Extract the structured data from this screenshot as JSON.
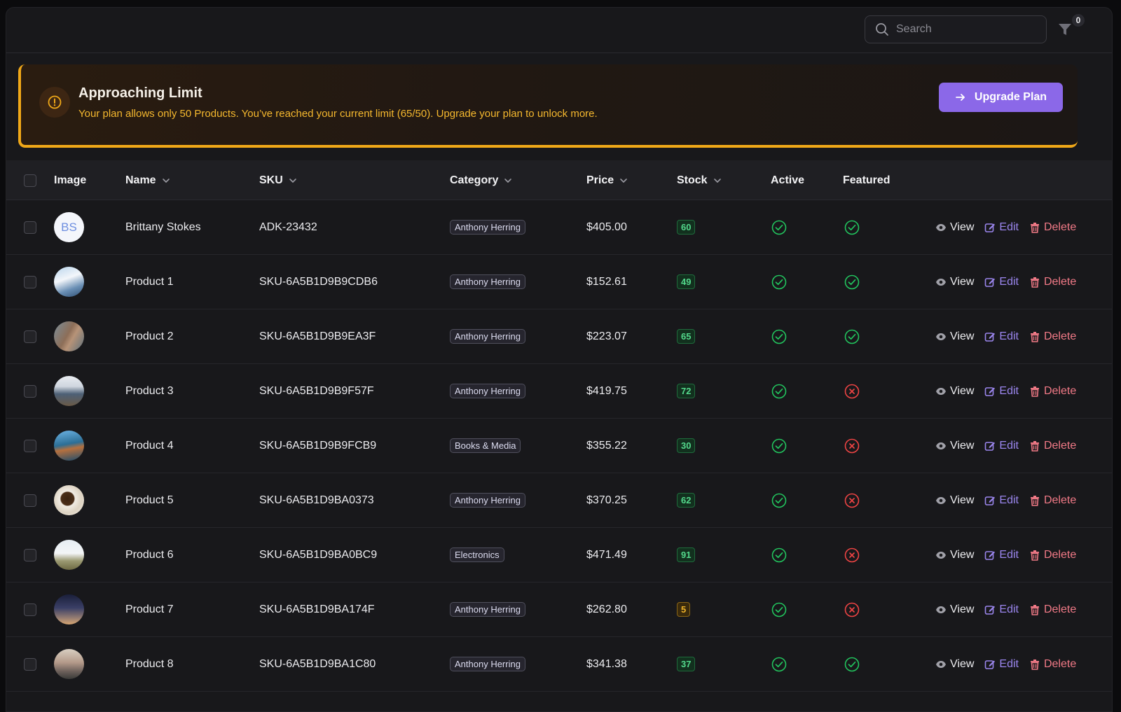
{
  "search": {
    "placeholder": "Search"
  },
  "filter": {
    "count": "0"
  },
  "alert": {
    "title": "Approaching Limit",
    "message": "Your plan allows only 50 Products. You’ve reached your current limit (65/50). Upgrade your plan to unlock more.",
    "button_label": "Upgrade Plan"
  },
  "table": {
    "columns": {
      "image": "Image",
      "name": "Name",
      "sku": "SKU",
      "category": "Category",
      "price": "Price",
      "stock": "Stock",
      "active": "Active",
      "featured": "Featured"
    },
    "actions": {
      "view": "View",
      "edit": "Edit",
      "delete": "Delete"
    },
    "rows": [
      {
        "initials": "BS",
        "name": "Brittany Stokes",
        "sku": "ADK-23432",
        "category": "Anthony Herring",
        "price": "$405.00",
        "stock": "60",
        "stock_level": "normal",
        "active": true,
        "featured": true
      },
      {
        "image": "product-photo-white-ship",
        "name": "Product 1",
        "sku": "SKU-6A5B1D9B9CDB6",
        "category": "Anthony Herring",
        "price": "$152.61",
        "stock": "49",
        "stock_level": "normal",
        "active": true,
        "featured": true
      },
      {
        "image": "product-photo-building",
        "name": "Product 2",
        "sku": "SKU-6A5B1D9B9EA3F",
        "category": "Anthony Herring",
        "price": "$223.07",
        "stock": "65",
        "stock_level": "normal",
        "active": true,
        "featured": true
      },
      {
        "image": "product-photo-mountain-sea",
        "name": "Product 3",
        "sku": "SKU-6A5B1D9B9F57F",
        "category": "Anthony Herring",
        "price": "$419.75",
        "stock": "72",
        "stock_level": "normal",
        "active": true,
        "featured": false
      },
      {
        "image": "product-photo-coast",
        "name": "Product 4",
        "sku": "SKU-6A5B1D9B9FCB9",
        "category": "Books & Media",
        "price": "$355.22",
        "stock": "30",
        "stock_level": "normal",
        "active": true,
        "featured": false
      },
      {
        "image": "product-photo-coffee-cup",
        "name": "Product 5",
        "sku": "SKU-6A5B1D9BA0373",
        "category": "Anthony Herring",
        "price": "$370.25",
        "stock": "62",
        "stock_level": "normal",
        "active": true,
        "featured": false
      },
      {
        "image": "product-photo-field",
        "name": "Product 6",
        "sku": "SKU-6A5B1D9BA0BC9",
        "category": "Electronics",
        "price": "$471.49",
        "stock": "91",
        "stock_level": "normal",
        "active": true,
        "featured": false
      },
      {
        "image": "product-photo-dusk-sky",
        "name": "Product 7",
        "sku": "SKU-6A5B1D9BA174F",
        "category": "Anthony Herring",
        "price": "$262.80",
        "stock": "5",
        "stock_level": "low",
        "active": true,
        "featured": false
      },
      {
        "image": "product-photo-sunset-clouds",
        "name": "Product 8",
        "sku": "SKU-6A5B1D9BA1C80",
        "category": "Anthony Herring",
        "price": "$341.38",
        "stock": "37",
        "stock_level": "normal",
        "active": true,
        "featured": true
      }
    ]
  },
  "colors": {
    "accent": "#8b68e8",
    "warning": "#f0a818",
    "success": "#22c55e",
    "danger": "#ef4444",
    "edit": "#9b86ee",
    "delete": "#f27a87"
  }
}
